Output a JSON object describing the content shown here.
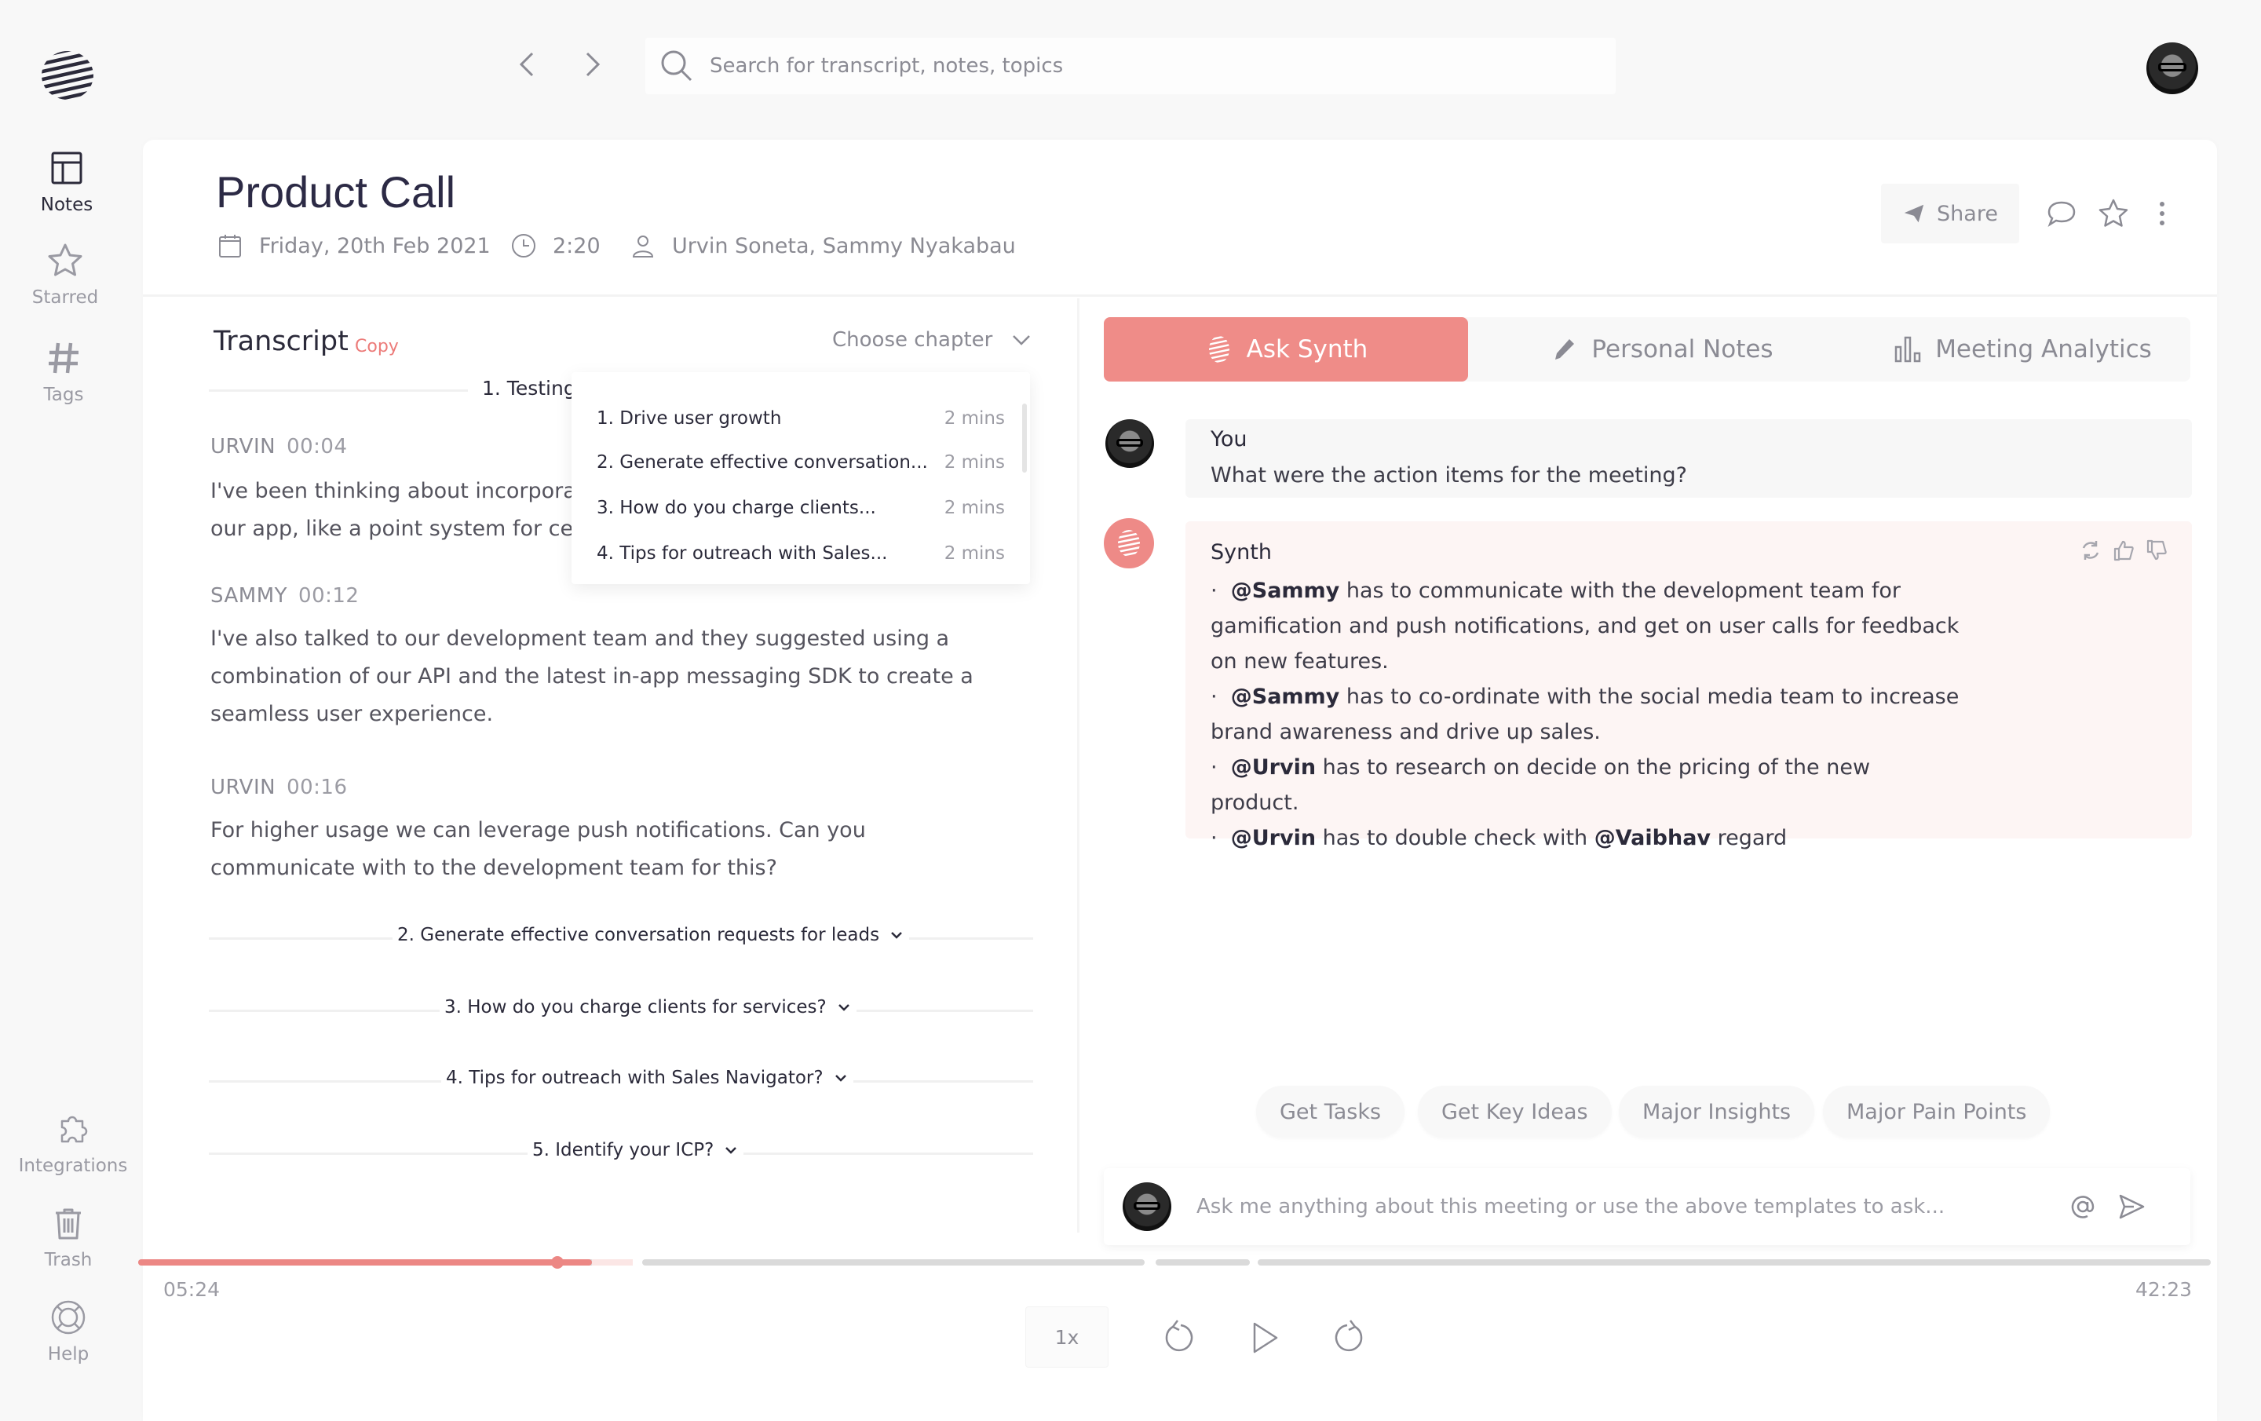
{
  "sidebar": {
    "top_items": [
      {
        "label": "Notes",
        "icon": "notes-layout-icon",
        "active": true
      },
      {
        "label": "Starred",
        "icon": "star-icon",
        "active": false
      },
      {
        "label": "Tags",
        "icon": "hash-icon",
        "active": false
      }
    ],
    "bottom_items": [
      {
        "label": "Integrations",
        "icon": "puzzle-icon"
      },
      {
        "label": "Trash",
        "icon": "trash-icon"
      },
      {
        "label": "Help",
        "icon": "lifebuoy-icon"
      }
    ]
  },
  "topbar": {
    "search_placeholder": "Search for transcript, notes, topics"
  },
  "meeting": {
    "title": "Product Call",
    "date": "Friday, 20th Feb 2021",
    "duration": "2:20",
    "participants": "Urvin Soneta, Sammy Nyakabau",
    "share_label": "Share"
  },
  "transcript": {
    "title": "Transcript",
    "copy_label": "Copy",
    "chapter_select_label": "Choose chapter",
    "current_chapter": "1. Testing",
    "entries": [
      {
        "speaker": "URVIN",
        "time": "00:04",
        "text": "I've been thinking about incorporating gamification into our app, like a point system for certa"
      },
      {
        "speaker": "SAMMY",
        "time": "00:12",
        "text": " I've also talked to our development team and they suggested using a combination of our API and the latest in-app messaging SDK to create a seamless user experience."
      },
      {
        "speaker": "URVIN",
        "time": "00:16",
        "text": "For higher usage we can leverage push notifications. Can you communicate with to the development team for this?"
      }
    ],
    "entry1_line1": "I've been thinking about incorporatin",
    "entry1_line2": "our app, like a point system for certa",
    "collapsed_chapters": [
      "2. Generate effective conversation requests for leads",
      "3. How do you charge clients for services?",
      "4. Tips for outreach with Sales Navigator?",
      "5. Identify your ICP?"
    ]
  },
  "chapter_dropdown": {
    "items": [
      {
        "name": "1. Drive user growth",
        "duration": "2 mins"
      },
      {
        "name": "2. Generate effective conversation...",
        "duration": "2 mins"
      },
      {
        "name": "3. How do you charge clients...",
        "duration": "2 mins"
      },
      {
        "name": "4. Tips for outreach with Sales...",
        "duration": "2 mins"
      }
    ]
  },
  "right_panel": {
    "tabs": [
      {
        "label": "Ask Synth",
        "active": true
      },
      {
        "label": "Personal Notes",
        "active": false
      },
      {
        "label": "Meeting Analytics",
        "active": false
      }
    ],
    "messages": {
      "you": {
        "author": "You",
        "text": "What were the action items for the meeting?"
      },
      "synth": {
        "author": "Synth",
        "bullets": [
          {
            "mention": "@Sammy",
            "text": " has to communicate with the development team for gamification and push notifications, and get on user calls for feedback on new features."
          },
          {
            "mention": "@Sammy",
            "text": " has to co-ordinate with the social media team to increase brand awareness and drive up sales."
          },
          {
            "mention": "@Urvin",
            "text": " has to research on decide on the pricing of the new product."
          },
          {
            "mention": "@Urvin",
            "text": " has to double check with ",
            "mention2": "@Vaibhav",
            "tail": " regard"
          }
        ]
      }
    },
    "templates": [
      "Get Tasks",
      "Get Key Ideas",
      "Major Insights",
      "Major Pain Points"
    ],
    "ask_placeholder": "Ask me anything about this meeting or use the above templates to ask..."
  },
  "player": {
    "current_time": "05:24",
    "total_time": "42:23",
    "progress_fraction": 0.128,
    "speed": "1x"
  },
  "colors": {
    "accent": "#ef8c88",
    "text_primary": "#2b2a3a",
    "text_muted": "#8b8b94"
  }
}
